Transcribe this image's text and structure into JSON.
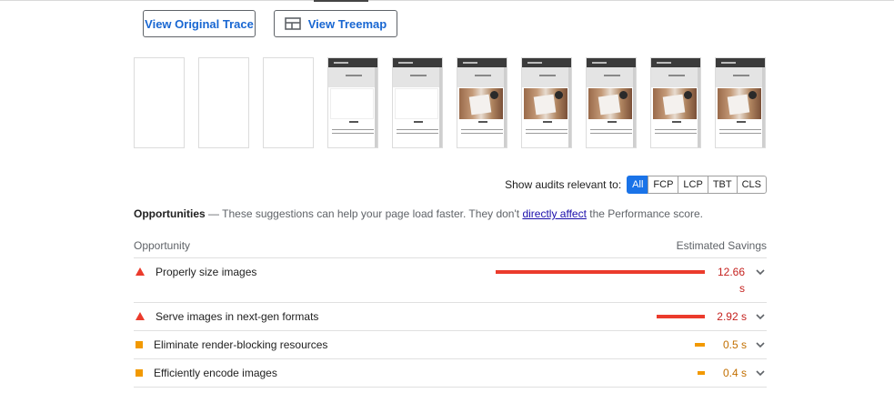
{
  "buttons": {
    "view_trace": "View Original Trace",
    "view_treemap": "View Treemap"
  },
  "filmstrip": {
    "frames": [
      {
        "state": "blank"
      },
      {
        "state": "blank"
      },
      {
        "state": "blank"
      },
      {
        "state": "loaded-no-image"
      },
      {
        "state": "loaded-no-image"
      },
      {
        "state": "loaded-image"
      },
      {
        "state": "loaded-image"
      },
      {
        "state": "loaded-image"
      },
      {
        "state": "loaded-image"
      },
      {
        "state": "loaded-image"
      }
    ]
  },
  "filter": {
    "label": "Show audits relevant to:",
    "chips": [
      "All",
      "FCP",
      "LCP",
      "TBT",
      "CLS"
    ],
    "active": "All"
  },
  "opportunities": {
    "title": "Opportunities",
    "dash": "—",
    "intro_before": "These suggestions can help your page load faster. They don't",
    "intro_link": "directly affect",
    "intro_after": "the Performance score.",
    "col_opportunity": "Opportunity",
    "col_savings": "Estimated Savings",
    "rows": [
      {
        "title": "Properly size images",
        "savings": "12.66 s",
        "savings_top": "12.66",
        "savings_unit": "s",
        "severity": "fail",
        "share": 1.0
      },
      {
        "title": "Serve images in next-gen formats",
        "savings": "2.92 s",
        "severity": "fail",
        "share": 0.23
      },
      {
        "title": "Eliminate render-blocking resources",
        "savings": "0.5 s",
        "severity": "average",
        "share": 0.04
      },
      {
        "title": "Efficiently encode images",
        "savings": "0.4 s",
        "severity": "average",
        "share": 0.03
      }
    ]
  },
  "colors": {
    "fail": "#eb3b2c",
    "average": "#f29900",
    "accent": "#1a73e8"
  },
  "icons": {
    "treemap": "treemap-icon",
    "fail": "triangle-fail-icon",
    "average": "square-average-icon",
    "expand": "chevron-down-icon"
  }
}
